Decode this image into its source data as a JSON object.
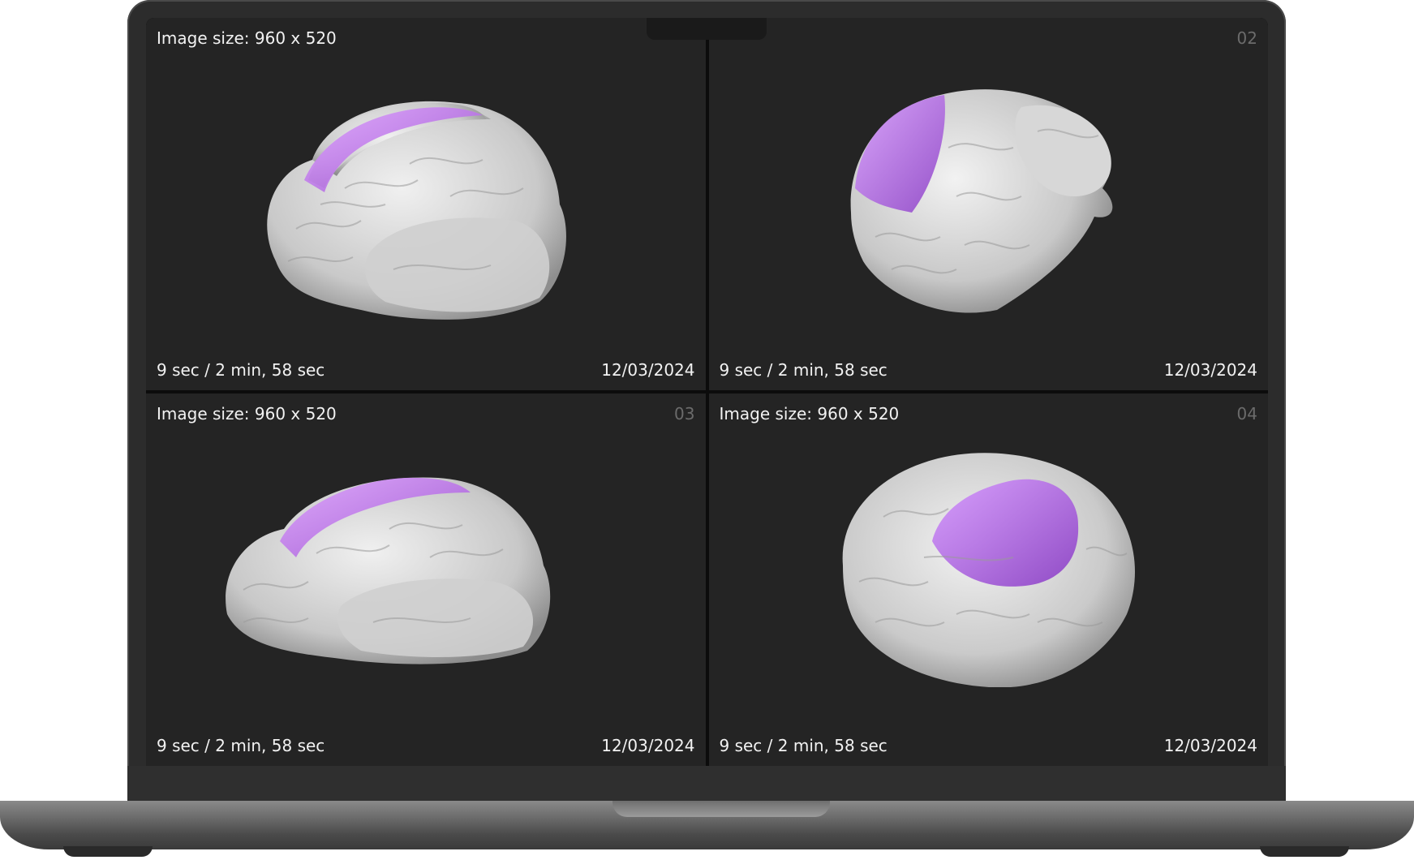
{
  "viewer": {
    "panels": [
      {
        "size_label": "Image size: 960 x 520",
        "index": "",
        "duration": "9 sec / 2 min, 58 sec",
        "date": "12/03/2024",
        "view": "lateral-left"
      },
      {
        "size_label": "",
        "index": "02",
        "duration": "9 sec / 2 min, 58 sec",
        "date": "12/03/2024",
        "view": "posterior-oblique"
      },
      {
        "size_label": "Image size: 960 x 520",
        "index": "03",
        "duration": "9 sec / 2 min, 58 sec",
        "date": "12/03/2024",
        "view": "lateral-left"
      },
      {
        "size_label": "Image size: 960 x 520",
        "index": "04",
        "duration": "9 sec / 2 min, 58 sec",
        "date": "12/03/2024",
        "view": "superior-oblique"
      }
    ]
  },
  "colors": {
    "panel_bg": "#242424",
    "brain": "#d9d9d9",
    "highlight": "#b066e0",
    "bezel": "#2c2c2c"
  }
}
